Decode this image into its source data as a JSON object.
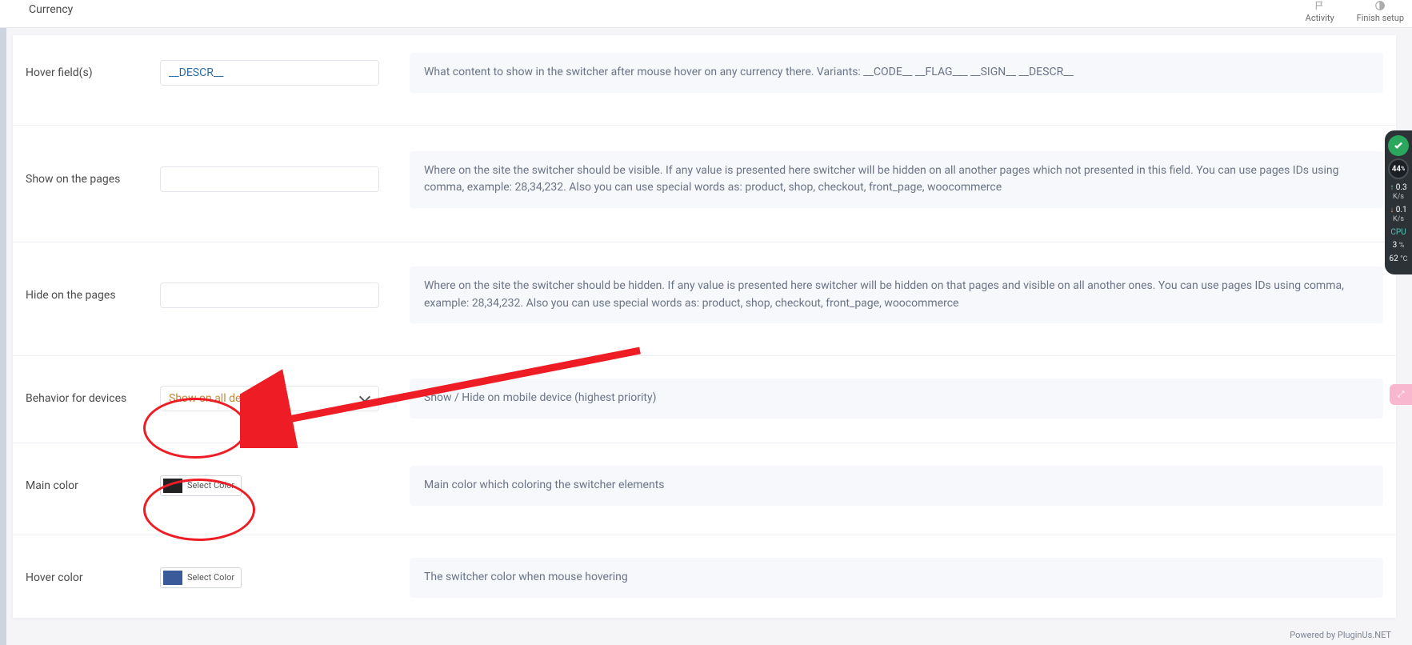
{
  "topbar": {
    "title": "Currency",
    "activity": "Activity",
    "finish": "Finish setup"
  },
  "rows": {
    "hover_fields": {
      "label": "Hover field(s)",
      "value": "__DESCR__",
      "desc": "What content to show in the switcher after mouse hover on any currency there. Variants: __CODE__ __FLAG___ __SIGN__ __DESCR__"
    },
    "show_pages": {
      "label": "Show on the pages",
      "value": "",
      "desc": "Where on the site the switcher should be visible. If any value is presented here switcher will be hidden on all another pages which not presented in this field. You can use pages IDs using comma, example: 28,34,232. Also you can use special words as: product, shop, checkout, front_page, woocommerce"
    },
    "hide_pages": {
      "label": "Hide on the pages",
      "value": "",
      "desc": "Where on the site the switcher should be hidden. If any value is presented here switcher will be hidden on that pages and visible on all another ones. You can use pages IDs using comma, example: 28,34,232. Also you can use special words as: product, shop, checkout, front_page, woocommerce"
    },
    "behavior": {
      "label": "Behavior for devices",
      "value": "Show on all devices",
      "desc": "Show / Hide on mobile device (highest priority)"
    },
    "main_color": {
      "label": "Main color",
      "btn": "Select Color",
      "swatch": "#222222",
      "desc": "Main color which coloring the switcher elements"
    },
    "hover_color": {
      "label": "Hover color",
      "btn": "Select Color",
      "swatch": "#3b5a9a",
      "desc": "The switcher color when mouse hovering"
    }
  },
  "monitor": {
    "pct": "44",
    "pct_unit": "%",
    "up": "0.3",
    "up_unit": "K/s",
    "down": "0.1",
    "down_unit": "K/s",
    "cpu_label": "CPU",
    "cpu_pct": "3",
    "cpu_pct_unit": "%",
    "temp": "62",
    "temp_unit": "°C"
  },
  "footer": "Powered by PluginUs.NET",
  "pinktab": "⤢"
}
